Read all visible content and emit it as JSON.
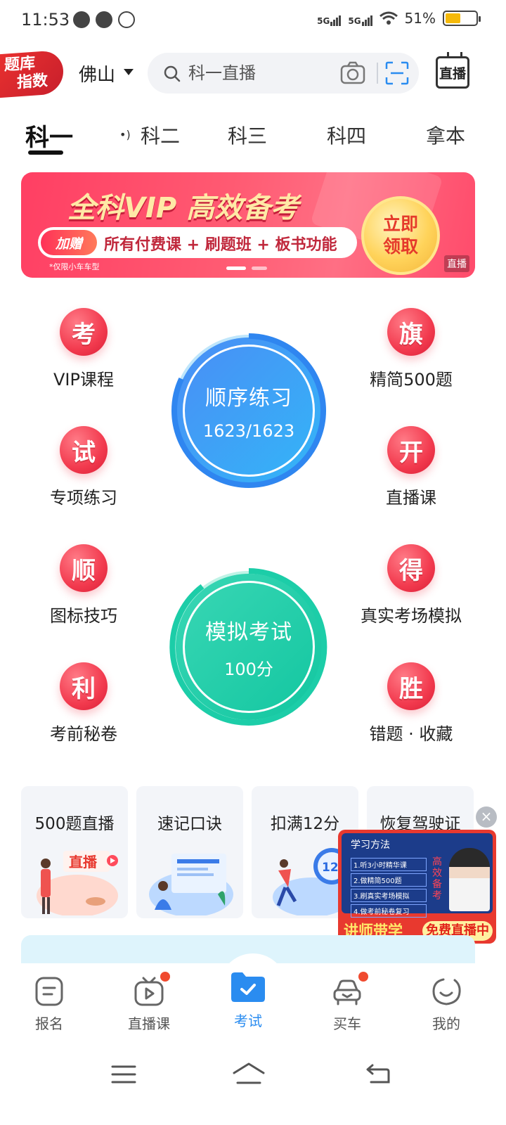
{
  "status_bar": {
    "time": "11:53",
    "signal1": "5G",
    "signal2": "5G",
    "battery_text": "51%",
    "battery_level": 0.51
  },
  "header": {
    "logo_line1": "题库",
    "logo_line2": "指数",
    "city": "佛山",
    "search_placeholder": "科一直播",
    "live_button": "直播"
  },
  "subject_tabs": [
    {
      "label": "科一",
      "active": true
    },
    {
      "label": "科二",
      "active": false
    },
    {
      "label": "科三",
      "active": false
    },
    {
      "label": "科四",
      "active": false
    },
    {
      "label": "拿本",
      "active": false
    }
  ],
  "banner": {
    "title": "全科VIP 高效备考",
    "gift_label": "加赠",
    "perks": "所有付费课 + 刷题班 + 板书功能",
    "note": "*仅限小车车型",
    "claim_line1": "立即",
    "claim_line2": "领取",
    "corner_tag": "直播"
  },
  "features_left": [
    {
      "badge": "考",
      "label": "VIP课程"
    },
    {
      "badge": "试",
      "label": "专项练习"
    },
    {
      "badge": "顺",
      "label": "图标技巧"
    },
    {
      "badge": "利",
      "label": "考前秘卷"
    }
  ],
  "features_right": [
    {
      "badge": "旗",
      "label": "精简500题"
    },
    {
      "badge": "开",
      "label": "直播课"
    },
    {
      "badge": "得",
      "label": "真实考场模拟"
    },
    {
      "badge": "胜",
      "label": "错题 · 收藏"
    }
  ],
  "practice_circle": {
    "title": "顺序练习",
    "progress_text": "1623/1623",
    "progress": 1.0
  },
  "exam_circle": {
    "title": "模拟考试",
    "score_text": "100分"
  },
  "cards": [
    {
      "title": "500题直播",
      "tag": "直播"
    },
    {
      "title": "速记口诀"
    },
    {
      "title": "扣满12分",
      "tag": "12分"
    },
    {
      "title": "恢复驾驶证"
    }
  ],
  "promo": {
    "close": "×",
    "screen_title": "学习方法",
    "steps": [
      "1.听3小时精华课",
      "2.做精简500题",
      "3.刷真实考场模拟",
      "4.做考前秘卷复习"
    ],
    "vertical_text": "高效备考",
    "footer_left": "讲师带学",
    "footer_right": "免费直播中"
  },
  "bottom_nav": [
    {
      "label": "报名",
      "icon": "form-icon",
      "active": false
    },
    {
      "label": "直播课",
      "icon": "tv-play-icon",
      "active": false,
      "dot": true
    },
    {
      "label": "考试",
      "icon": "folder-check-icon",
      "active": true
    },
    {
      "label": "买车",
      "icon": "car-icon",
      "active": false,
      "dot": true
    },
    {
      "label": "我的",
      "icon": "smile-icon",
      "active": false
    }
  ],
  "colors": {
    "accent": "#2a8cf0",
    "badge_red": "#f23a4e",
    "practice_blue": "#3d8ff5",
    "exam_green": "#1fd0ae"
  }
}
